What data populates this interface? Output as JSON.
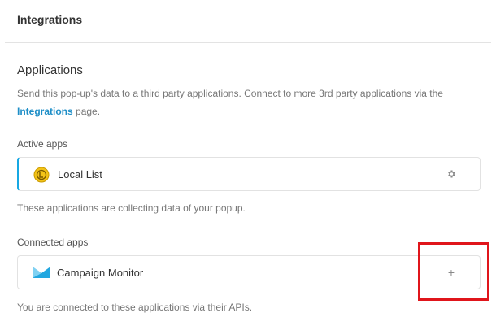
{
  "header": {
    "title": "Integrations"
  },
  "applications": {
    "title": "Applications",
    "description_prefix": "Send this pop-up's data to a third party applications. Connect to more 3rd party applications via the",
    "description_link": "Integrations",
    "description_suffix": "page."
  },
  "active_apps": {
    "label": "Active apps",
    "items": [
      {
        "name": "Local List",
        "icon": "local-list-icon",
        "action_icon": "gear-icon"
      }
    ],
    "note": "These applications are collecting data of your popup."
  },
  "connected_apps": {
    "label": "Connected apps",
    "items": [
      {
        "name": "Campaign Monitor",
        "icon": "campaign-monitor-icon",
        "action_icon": "plus-icon"
      }
    ],
    "note": "You are connected to these applications via their APIs."
  },
  "colors": {
    "accent": "#1e8ec7",
    "active_border": "#17a8e3",
    "highlight": "#e0151b",
    "local_list_icon": "#f3c318",
    "campaign_monitor_icon": "#22a7e0"
  }
}
